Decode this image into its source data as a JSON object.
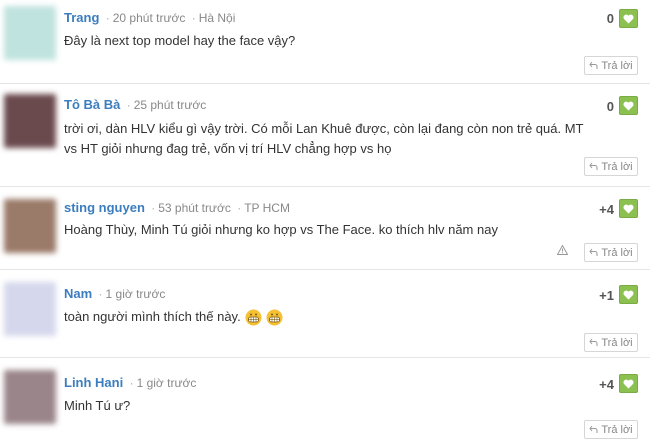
{
  "comments": [
    {
      "name": "Trang",
      "time": "20 phút trước",
      "location": "Hà Nội",
      "text": "Đây là next top model hay the face vậy?",
      "score": "0",
      "reply": "Trả lời",
      "avatar_color": "#bfe3de"
    },
    {
      "name": "Tô Bà Bà",
      "time": "25 phút trước",
      "location": "",
      "text": "trời ơi, dàn HLV kiểu gì vậy trời. Có mỗi Lan Khuê được, còn lại đang còn non trẻ quá. MT vs HT giỏi nhưng đag trẻ, vốn vị trí HLV chẳng hợp vs họ",
      "score": "0",
      "reply": "Trả lời",
      "avatar_color": "#6b4a4e"
    },
    {
      "name": "sting nguyen",
      "time": "53 phút trước",
      "location": "TP HCM",
      "text": "Hoàng Thùy, Minh Tú giỏi nhưng ko hợp vs The Face. ko thích hlv năm nay",
      "score": "+4",
      "reply": "Trả lời",
      "avatar_color": "#9a7a68"
    },
    {
      "name": "Nam",
      "time": "1 giờ trước",
      "location": "",
      "text": "toàn người mình thích thế này.",
      "score": "+1",
      "reply": "Trả lời",
      "avatar_color": "#d5d8ec"
    },
    {
      "name": "Linh Hani",
      "time": "1 giờ trước",
      "location": "",
      "text": "Minh Tú ư?",
      "score": "+4",
      "reply": "Trả lời",
      "avatar_color": "#9a868a"
    }
  ]
}
